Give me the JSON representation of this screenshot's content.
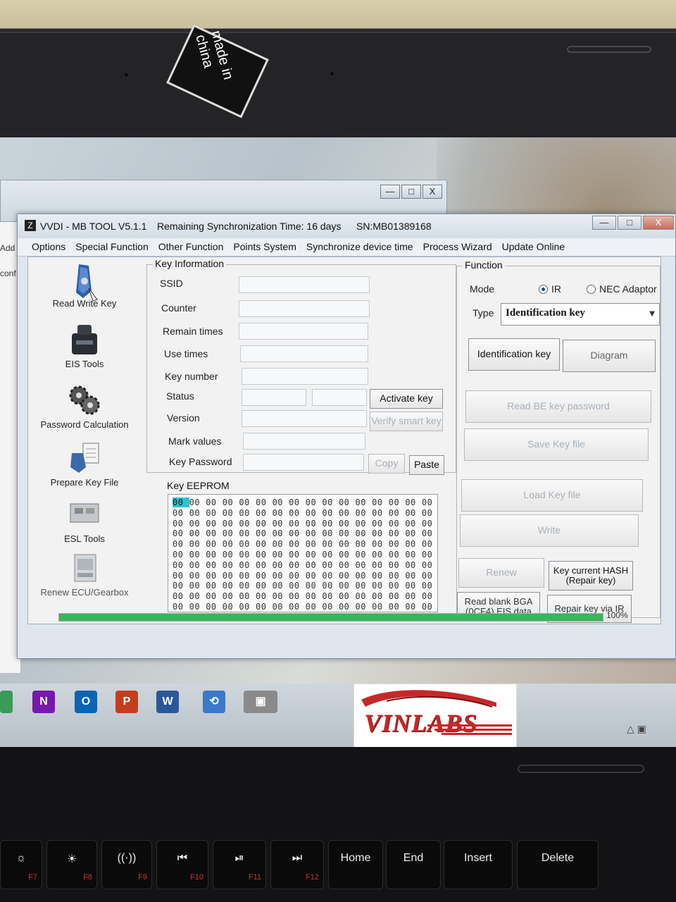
{
  "bezel": {
    "sticker_text": "made in china"
  },
  "background_window": {
    "buttons": [
      "—",
      "□",
      "X"
    ]
  },
  "left_strip": {
    "items": [
      "Add",
      "conf"
    ]
  },
  "app": {
    "title": "VVDI - MB TOOL V5.1.1",
    "sync_time": "Remaining Synchronization Time: 16 days",
    "serial": "SN:MB01389168",
    "window_buttons": [
      "—",
      "□",
      "X"
    ]
  },
  "menu": [
    "Options",
    "Special Function",
    "Other Function",
    "Points System",
    "Synchronize device time",
    "Process Wizard",
    "Update Online"
  ],
  "sidebar": [
    {
      "label": "Read Write Key",
      "icon": "car-key-icon"
    },
    {
      "label": "EIS Tools",
      "icon": "eis-module-icon"
    },
    {
      "label": "Password Calculation",
      "icon": "gears-icon"
    },
    {
      "label": "Prepare Key File",
      "icon": "key-file-icon"
    },
    {
      "label": "ESL Tools",
      "icon": "esl-module-icon"
    },
    {
      "label": "Renew ECU/Gearbox",
      "icon": "ecu-module-icon"
    }
  ],
  "key_info": {
    "group_label": "Key Information",
    "fields": [
      "SSID",
      "Counter",
      "Remain times",
      "Use times",
      "Key number",
      "Status",
      "Version",
      "Mark values",
      "Key Password"
    ],
    "activate_key": "Activate key",
    "verify_smart_key": "Verify smart key",
    "copy": "Copy",
    "paste": "Paste"
  },
  "eeprom": {
    "group_label": "Key EEPROM",
    "rows": [
      [
        "00",
        "00",
        "00",
        "00",
        "00",
        "00",
        "00",
        "00",
        "00",
        "00",
        "00",
        "00",
        "00",
        "00",
        "00",
        "00"
      ],
      [
        "00",
        "00",
        "00",
        "00",
        "00",
        "00",
        "00",
        "00",
        "00",
        "00",
        "00",
        "00",
        "00",
        "00",
        "00",
        "00"
      ],
      [
        "00",
        "00",
        "00",
        "00",
        "00",
        "00",
        "00",
        "00",
        "00",
        "00",
        "00",
        "00",
        "00",
        "00",
        "00",
        "00"
      ],
      [
        "00",
        "00",
        "00",
        "00",
        "00",
        "00",
        "00",
        "00",
        "00",
        "00",
        "00",
        "00",
        "00",
        "00",
        "00",
        "00"
      ],
      [
        "00",
        "00",
        "00",
        "00",
        "00",
        "00",
        "00",
        "00",
        "00",
        "00",
        "00",
        "00",
        "00",
        "00",
        "00",
        "00"
      ],
      [
        "00",
        "00",
        "00",
        "00",
        "00",
        "00",
        "00",
        "00",
        "00",
        "00",
        "00",
        "00",
        "00",
        "00",
        "00",
        "00"
      ],
      [
        "00",
        "00",
        "00",
        "00",
        "00",
        "00",
        "00",
        "00",
        "00",
        "00",
        "00",
        "00",
        "00",
        "00",
        "00",
        "00"
      ],
      [
        "00",
        "00",
        "00",
        "00",
        "00",
        "00",
        "00",
        "00",
        "00",
        "00",
        "00",
        "00",
        "00",
        "00",
        "00",
        "00"
      ],
      [
        "00",
        "00",
        "00",
        "00",
        "00",
        "00",
        "00",
        "00",
        "00",
        "00",
        "00",
        "00",
        "00",
        "00",
        "00",
        "00"
      ],
      [
        "00",
        "00",
        "00",
        "00",
        "00",
        "00",
        "00",
        "00",
        "00",
        "00",
        "00",
        "00",
        "00",
        "00",
        "00",
        "00"
      ],
      [
        "00",
        "00",
        "00",
        "00",
        "00",
        "00",
        "00",
        "00",
        "00",
        "00",
        "00",
        "00",
        "00",
        "00",
        "00",
        "00"
      ]
    ]
  },
  "function": {
    "group_label": "Function",
    "mode_label": "Mode",
    "mode_ir": "IR",
    "mode_nec": "NEC Adaptor",
    "mode_selected": "IR",
    "type_label": "Type",
    "type_value": "Identification key",
    "identification_key": "Identification key",
    "diagram": "Diagram",
    "read_be_key_password": "Read BE key password",
    "save_key_file": "Save Key file",
    "load_key_file": "Load Key file",
    "write": "Write",
    "renew": "Renew",
    "key_current_hash": "Key current HASH\n(Repair key)",
    "read_blank_bga": "Read blank BGA\n(0CF4) EIS data",
    "repair_key_via_ir": "Repair key via IR"
  },
  "progress": {
    "value": 100,
    "label": "100%"
  },
  "taskbar": {
    "icons": [
      {
        "name": "onenote-icon",
        "glyph": "N",
        "color": "#7719aa"
      },
      {
        "name": "outlook-icon",
        "glyph": "O",
        "color": "#0a64b4"
      },
      {
        "name": "powerpoint-icon",
        "glyph": "P",
        "color": "#c43e1c"
      },
      {
        "name": "word-icon",
        "glyph": "W",
        "color": "#2b579a"
      },
      {
        "name": "network-tool-icon",
        "glyph": "⟲",
        "color": "#3a78c8"
      },
      {
        "name": "vvdi-tool-icon",
        "glyph": "▣",
        "color": "#8a8a8a"
      }
    ]
  },
  "logo": {
    "text": "VINLABS"
  },
  "keyboard": {
    "keys": [
      {
        "label": "☼",
        "fn": "F7"
      },
      {
        "label": "☀",
        "fn": "F8"
      },
      {
        "label": "((·))",
        "fn": "F9"
      },
      {
        "label": "⏮",
        "fn": "F10"
      },
      {
        "label": "⏯",
        "fn": "F11"
      },
      {
        "label": "⏭",
        "fn": "F12"
      },
      {
        "label": "Home",
        "fn": ""
      },
      {
        "label": "End",
        "fn": ""
      },
      {
        "label": "Insert",
        "fn": ""
      },
      {
        "label": "Delete",
        "fn": ""
      }
    ]
  }
}
